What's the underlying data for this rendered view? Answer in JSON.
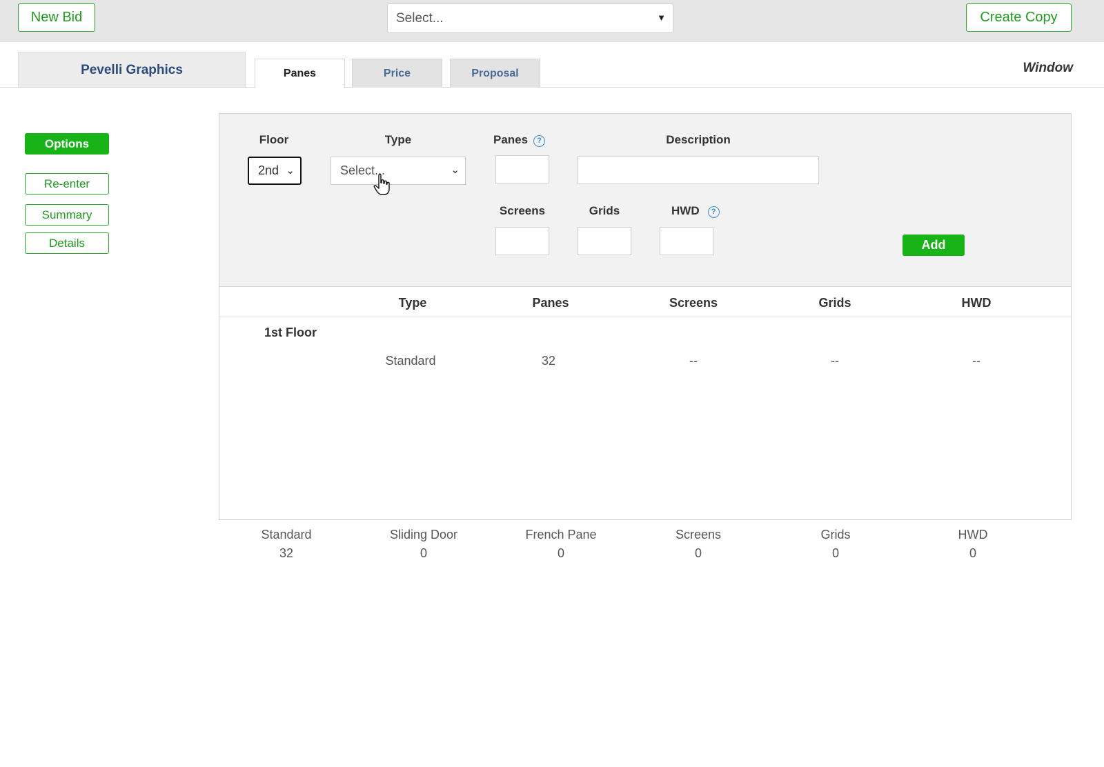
{
  "topbar": {
    "new_bid_label": "New Bid",
    "select_placeholder": "Select...",
    "create_copy_label": "Create Copy"
  },
  "tabs": {
    "company_name": "Pevelli Graphics",
    "items": [
      {
        "label": "Panes",
        "active": true
      },
      {
        "label": "Price",
        "active": false
      },
      {
        "label": "Proposal",
        "active": false
      }
    ],
    "window_label": "Window"
  },
  "sidebar": {
    "items": [
      {
        "label": "Options"
      },
      {
        "label": "Re-enter"
      },
      {
        "label": "Summary"
      },
      {
        "label": "Details"
      }
    ]
  },
  "form": {
    "floor_label": "Floor",
    "floor_value": "2nd",
    "type_label": "Type",
    "type_placeholder": "Select...",
    "panes_label": "Panes",
    "description_label": "Description",
    "screens_label": "Screens",
    "grids_label": "Grids",
    "hwd_label": "HWD",
    "help_symbol": "?",
    "add_label": "Add"
  },
  "table": {
    "headers": [
      "Type",
      "Panes",
      "Screens",
      "Grids",
      "HWD"
    ],
    "groups": [
      {
        "floor": "1st Floor",
        "rows": [
          {
            "type": "Standard",
            "panes": "32",
            "screens": "--",
            "grids": "--",
            "hwd": "--"
          }
        ]
      }
    ]
  },
  "totals": [
    {
      "label": "Standard",
      "value": "32"
    },
    {
      "label": "Sliding Door",
      "value": "0"
    },
    {
      "label": "French Pane",
      "value": "0"
    },
    {
      "label": "Screens",
      "value": "0"
    },
    {
      "label": "Grids",
      "value": "0"
    },
    {
      "label": "HWD",
      "value": "0"
    }
  ],
  "colors": {
    "accent_green": "#17b317",
    "company_blue": "#2b4a7a",
    "help_blue": "#3a8fd0"
  }
}
